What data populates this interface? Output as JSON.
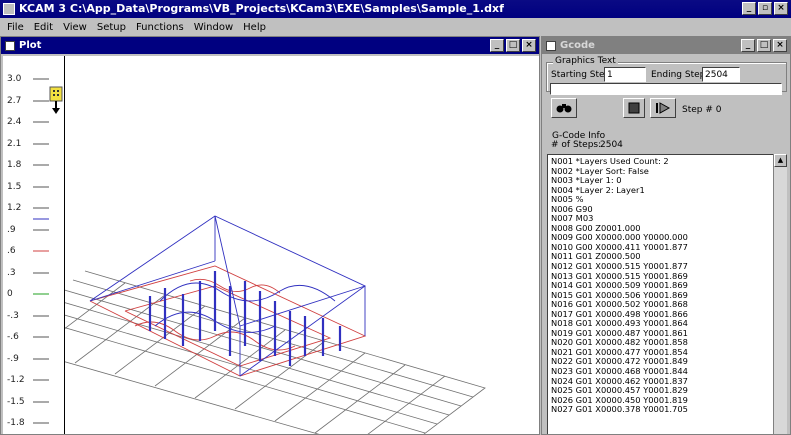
{
  "app": {
    "title": "KCAM 3  C:\\App_Data\\Programs\\VB_Projects\\KCam3\\EXE\\Samples\\Sample_1.dxf",
    "min_label": "_",
    "restore_label": "▫",
    "close_label": "×"
  },
  "menu": [
    "File",
    "Edit",
    "View",
    "Setup",
    "Functions",
    "Window",
    "Help"
  ],
  "plot": {
    "title": "Plot",
    "y_ticks": [
      "3.0",
      "2.7",
      "2.4",
      "2.1",
      "1.8",
      "1.5",
      "1.2",
      ".9",
      ".6",
      ".3",
      "0",
      "-.3",
      "-.6",
      "-.9",
      "-1.2",
      "-1.5",
      "-1.8"
    ]
  },
  "gcode": {
    "title": "Gcode",
    "graphics_text_label": "Graphics Text",
    "starting_step_label": "Starting Step:",
    "starting_step_value": "1",
    "ending_step_label": "Ending Step:",
    "ending_step_value": "2504",
    "step_label": "Step #  0",
    "info_label": "G-Code Info",
    "num_steps_label": "# of Steps:",
    "num_steps_value": "2504",
    "lines": [
      "N001 *Layers Used Count: 2",
      "N002 *Layer Sort: False",
      "N003 *Layer 1: 0",
      "N004 *Layer 2: Layer1",
      "N005 %",
      "N006 G90",
      "N007 M03",
      "N008 G00 Z0001.000",
      "N009 G00 X0000.000 Y0000.000",
      "N010 G00 X0000.411 Y0001.877",
      "N011 G01 Z0000.500",
      "N012 G01 X0000.515 Y0001.877",
      "N013 G01 X0000.515 Y0001.869",
      "N014 G01 X0000.509 Y0001.869",
      "N015 G01 X0000.506 Y0001.869",
      "N016 G01 X0000.502 Y0001.868",
      "N017 G01 X0000.498 Y0001.866",
      "N018 G01 X0000.493 Y0001.864",
      "N019 G01 X0000.487 Y0001.861",
      "N020 G01 X0000.482 Y0001.858",
      "N021 G01 X0000.477 Y0001.854",
      "N022 G01 X0000.472 Y0001.849",
      "N023 G01 X0000.468 Y0001.844",
      "N024 G01 X0000.462 Y0001.837",
      "N025 G01 X0000.457 Y0001.829",
      "N026 G01 X0000.450 Y0001.819",
      "N027 G01 X0000.378 Y0001.705"
    ]
  }
}
